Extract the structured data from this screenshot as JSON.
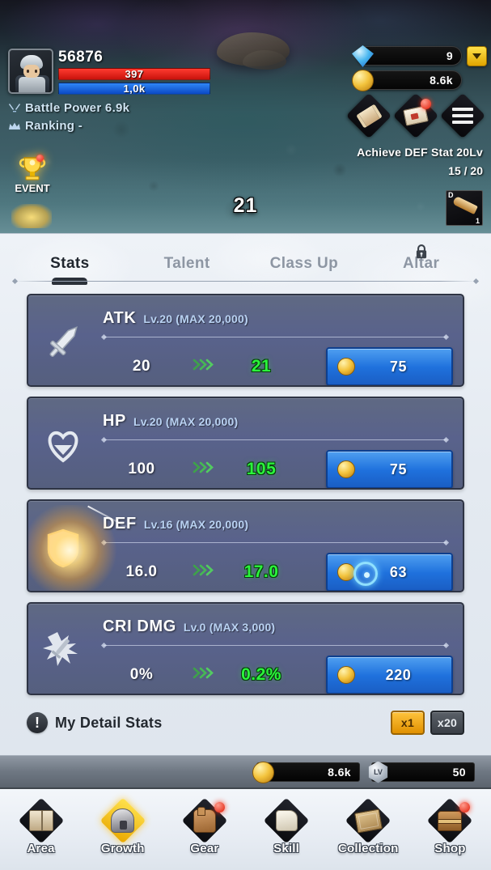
{
  "hud": {
    "player": {
      "id": "56876",
      "hp_value": "397",
      "mp_value": "1,0k",
      "battle_power_label": "Battle Power 6.9k",
      "ranking_label": "Ranking -",
      "swords_icon": "crossed-swords-icon",
      "crown_icon": "crown-icon",
      "avatar_icon": "player-avatar"
    },
    "event": {
      "label": "EVENT",
      "icon": "trophy-icon",
      "has_notification": true
    },
    "currencies": [
      {
        "name": "gem",
        "icon": "gem-icon",
        "value": "9"
      },
      {
        "name": "coin",
        "icon": "coin-icon",
        "value": "8.6k"
      }
    ],
    "collapse_icon": "chevron-down-icon",
    "icon_buttons": [
      {
        "name": "scroll",
        "icon": "scroll-icon",
        "badge": false
      },
      {
        "name": "mail",
        "icon": "mail-icon",
        "badge": true
      },
      {
        "name": "menu",
        "icon": "menu-icon",
        "badge": false
      }
    ],
    "quest": {
      "title": "Achieve DEF Stat 20Lv",
      "progress": "15 / 20",
      "reward_grade": "D",
      "reward_qty": "1",
      "reward_icon": "weapon-icon"
    },
    "damage_number": "21"
  },
  "tabs": [
    {
      "label": "Stats",
      "active": true,
      "locked": false
    },
    {
      "label": "Talent",
      "active": false,
      "locked": false
    },
    {
      "label": "Class Up",
      "active": false,
      "locked": false
    },
    {
      "label": "Altar",
      "active": false,
      "locked": true,
      "lock_icon": "lock-icon"
    }
  ],
  "stats": [
    {
      "name": "ATK",
      "level": "Lv.20 (MAX 20,000)",
      "current": "20",
      "next": "21",
      "price": "75",
      "icon": "sword-icon",
      "highlighted": false,
      "arrows": "»"
    },
    {
      "name": "HP",
      "level": "Lv.20 (MAX 20,000)",
      "current": "100",
      "next": "105",
      "price": "75",
      "icon": "heart-icon",
      "highlighted": false,
      "arrows": "»"
    },
    {
      "name": "DEF",
      "level": "Lv.16 (MAX 20,000)",
      "current": "16.0",
      "next": "17.0",
      "price": "63",
      "icon": "shield-icon",
      "highlighted": true,
      "arrows": "»"
    },
    {
      "name": "CRI DMG",
      "level": "Lv.0 (MAX 3,000)",
      "current": "0%",
      "next": "0.2%",
      "price": "220",
      "icon": "critical-hit-icon",
      "highlighted": false,
      "arrows": "»"
    }
  ],
  "detail_bar": {
    "icon": "info-icon",
    "label": "My Detail Stats",
    "multipliers": [
      {
        "label": "x1",
        "active": true
      },
      {
        "label": "x20",
        "active": false
      }
    ]
  },
  "bottom_currencies": [
    {
      "name": "coin",
      "icon": "coin-icon",
      "value": "8.6k"
    },
    {
      "name": "level",
      "icon": "level-icon",
      "badge_text": "LV",
      "value": "50"
    }
  ],
  "nav": [
    {
      "label": "Area",
      "icon": "map-book-icon",
      "selected": false,
      "badge": false
    },
    {
      "label": "Growth",
      "icon": "helmet-icon",
      "selected": true,
      "badge": false
    },
    {
      "label": "Gear",
      "icon": "glove-icon",
      "selected": false,
      "badge": true
    },
    {
      "label": "Skill",
      "icon": "skill-scroll-icon",
      "selected": false,
      "badge": false
    },
    {
      "label": "Collection",
      "icon": "tome-icon",
      "selected": false,
      "badge": false
    },
    {
      "label": "Shop",
      "icon": "chest-icon",
      "selected": false,
      "badge": true
    }
  ],
  "colors": {
    "accent_green": "#2bf43c",
    "buy_blue": "#1f71dd",
    "gold": "#e09000",
    "panel_bg": "#e4eaf1",
    "card_bg": "#59628c",
    "hp_red": "#c9120c",
    "mp_blue": "#0b49c4"
  }
}
